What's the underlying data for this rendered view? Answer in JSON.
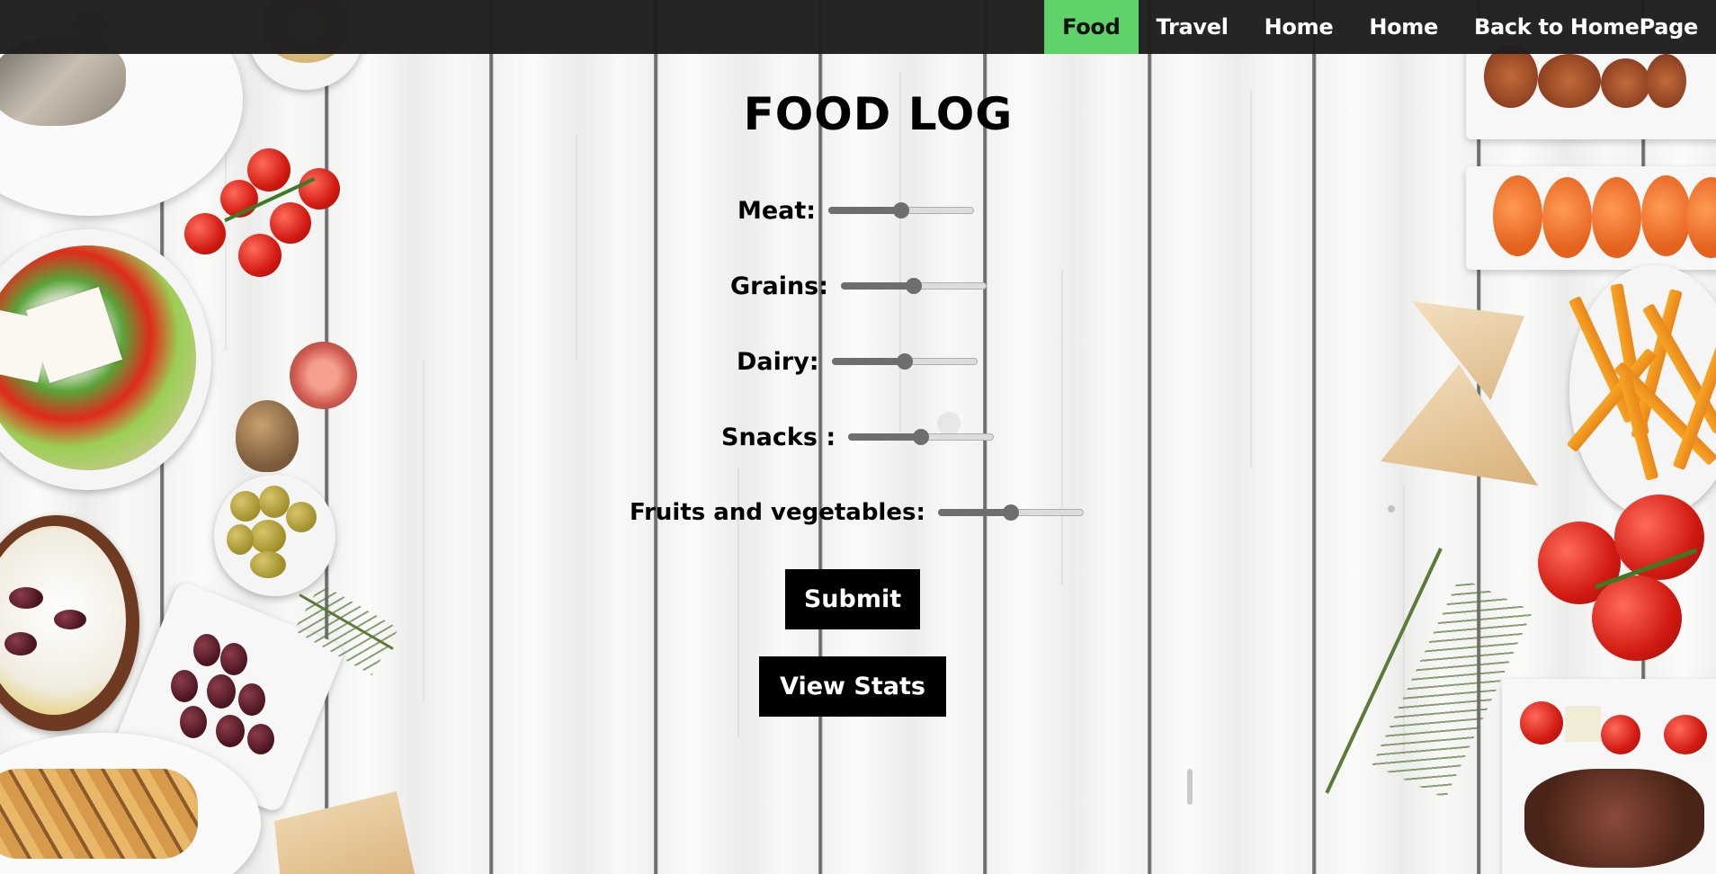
{
  "nav": {
    "links": [
      {
        "label": "Food",
        "active": true
      },
      {
        "label": "Travel",
        "active": false
      },
      {
        "label": "Home",
        "active": false
      },
      {
        "label": "Home",
        "active": false
      },
      {
        "label": "Back to HomePage",
        "active": false
      }
    ],
    "active_color": "#5fd36a",
    "bar_color": "#1e1e1e"
  },
  "page": {
    "title": "FOOD LOG"
  },
  "form": {
    "fields": [
      {
        "label": "Meat:",
        "value": 0.5
      },
      {
        "label": "Grains:",
        "value": 0.5
      },
      {
        "label": "Dairy:",
        "value": 0.5
      },
      {
        "label": "Snacks :",
        "value": 0.5
      },
      {
        "label": "Fruits and vegetables:",
        "value": 0.5
      }
    ],
    "submit_label": "Submit",
    "stats_label": "View Stats"
  }
}
